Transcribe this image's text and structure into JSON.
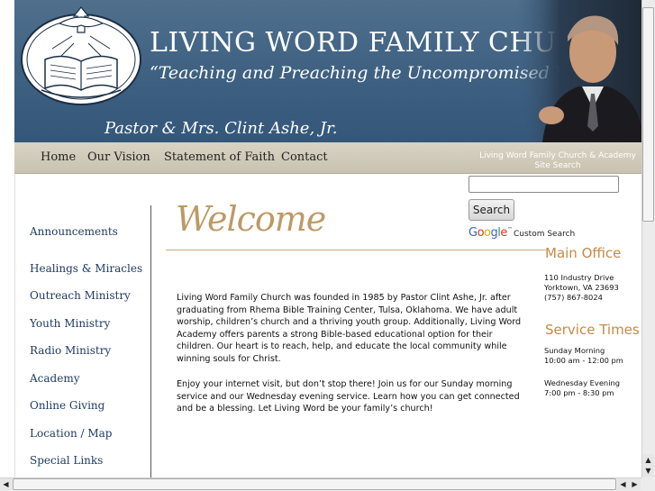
{
  "header": {
    "title": "LIVING WORD FAMILY CHURCH",
    "tagline": "“Teaching and Preaching the Uncompromised Word of God”",
    "pastors": "Pastor & Mrs. Clint Ashe, Jr.",
    "bg_color": "#3e6081"
  },
  "nav": {
    "items": [
      "Home",
      "Our Vision",
      "Statement of Faith",
      "Contact"
    ],
    "search_caption_line1": "Living Word Family Church & Academy",
    "search_caption_line2": "Site Search"
  },
  "search": {
    "input_value": "",
    "button_label": "Search",
    "google_label": "Google",
    "custom_search_label": "Custom Search"
  },
  "sidebar": {
    "items": [
      "Announcements",
      "Healings & Miracles",
      "Outreach Ministry",
      "Youth Ministry",
      "Radio Ministry",
      "Academy",
      "Online Giving",
      "Location / Map",
      "Special Links"
    ]
  },
  "main": {
    "heading": "Welcome",
    "paragraph1": "Living Word Family Church was founded in 1985 by Pastor Clint Ashe, Jr. after graduating from Rhema Bible Training Center, Tulsa, Oklahoma. We have adult worship, children’s church and a thriving youth group. Additionally, Living Word Academy offers parents a strong Bible-based educational option for their children. Our heart is to reach, help, and educate the local community while winning souls for Christ.",
    "paragraph2": "Enjoy your internet visit, but don’t stop there! Join us for our Sunday morning service and our Wednesday evening service. Learn how you can get connected and be a blessing. Let Living Word be your family’s church!"
  },
  "office": {
    "heading": "Main Office",
    "address1": "110 Industry Drive",
    "address2": "Yorktown, VA 23693",
    "phone": "(757) 867-8024"
  },
  "services": {
    "heading": "Service Times",
    "sunday_label": "Sunday Morning",
    "sunday_time": "10:00 am - 12:00 pm",
    "wednesday_label": "Wednesday Evening",
    "wednesday_time": "7:00 pm - 8:30 pm"
  },
  "colors": {
    "accent_gold": "#bc9a66",
    "heading_orange": "#c58a45",
    "link_blue": "#1f3b63"
  }
}
